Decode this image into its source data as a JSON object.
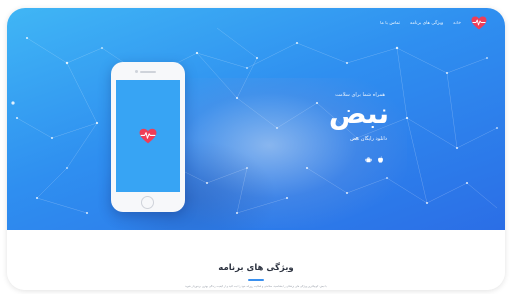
{
  "colors": {
    "hero_gradient_start": "#40b6f5",
    "hero_gradient_end": "#2b6ee6",
    "heart_red": "#ef3d57",
    "screen_blue": "#37a4f4",
    "accent": "#3a90ef"
  },
  "nav": {
    "logo_icon": "heart-pulse-icon",
    "items": [
      {
        "label": "خانه"
      },
      {
        "label": "ویژگی های برنامه"
      },
      {
        "label": "تماس با ما"
      }
    ]
  },
  "hero": {
    "tagline": "همراه شما برای سلامت",
    "title": "نبض",
    "download_text": "دانلود رایگان نبض",
    "store_icons": [
      "android-icon",
      "apple-icon"
    ]
  },
  "phone": {
    "screen_icon": "heart-pulse-icon"
  },
  "features": {
    "title": "ویژگی های برنامه",
    "description": "با نبض، کوچکترین ویژگی های پزشکی را بشناسید، سلامتی و فعالیت روزانه خود را ثبت کنید و از کیفیت زندگی بهتری برخوردار شوید"
  }
}
